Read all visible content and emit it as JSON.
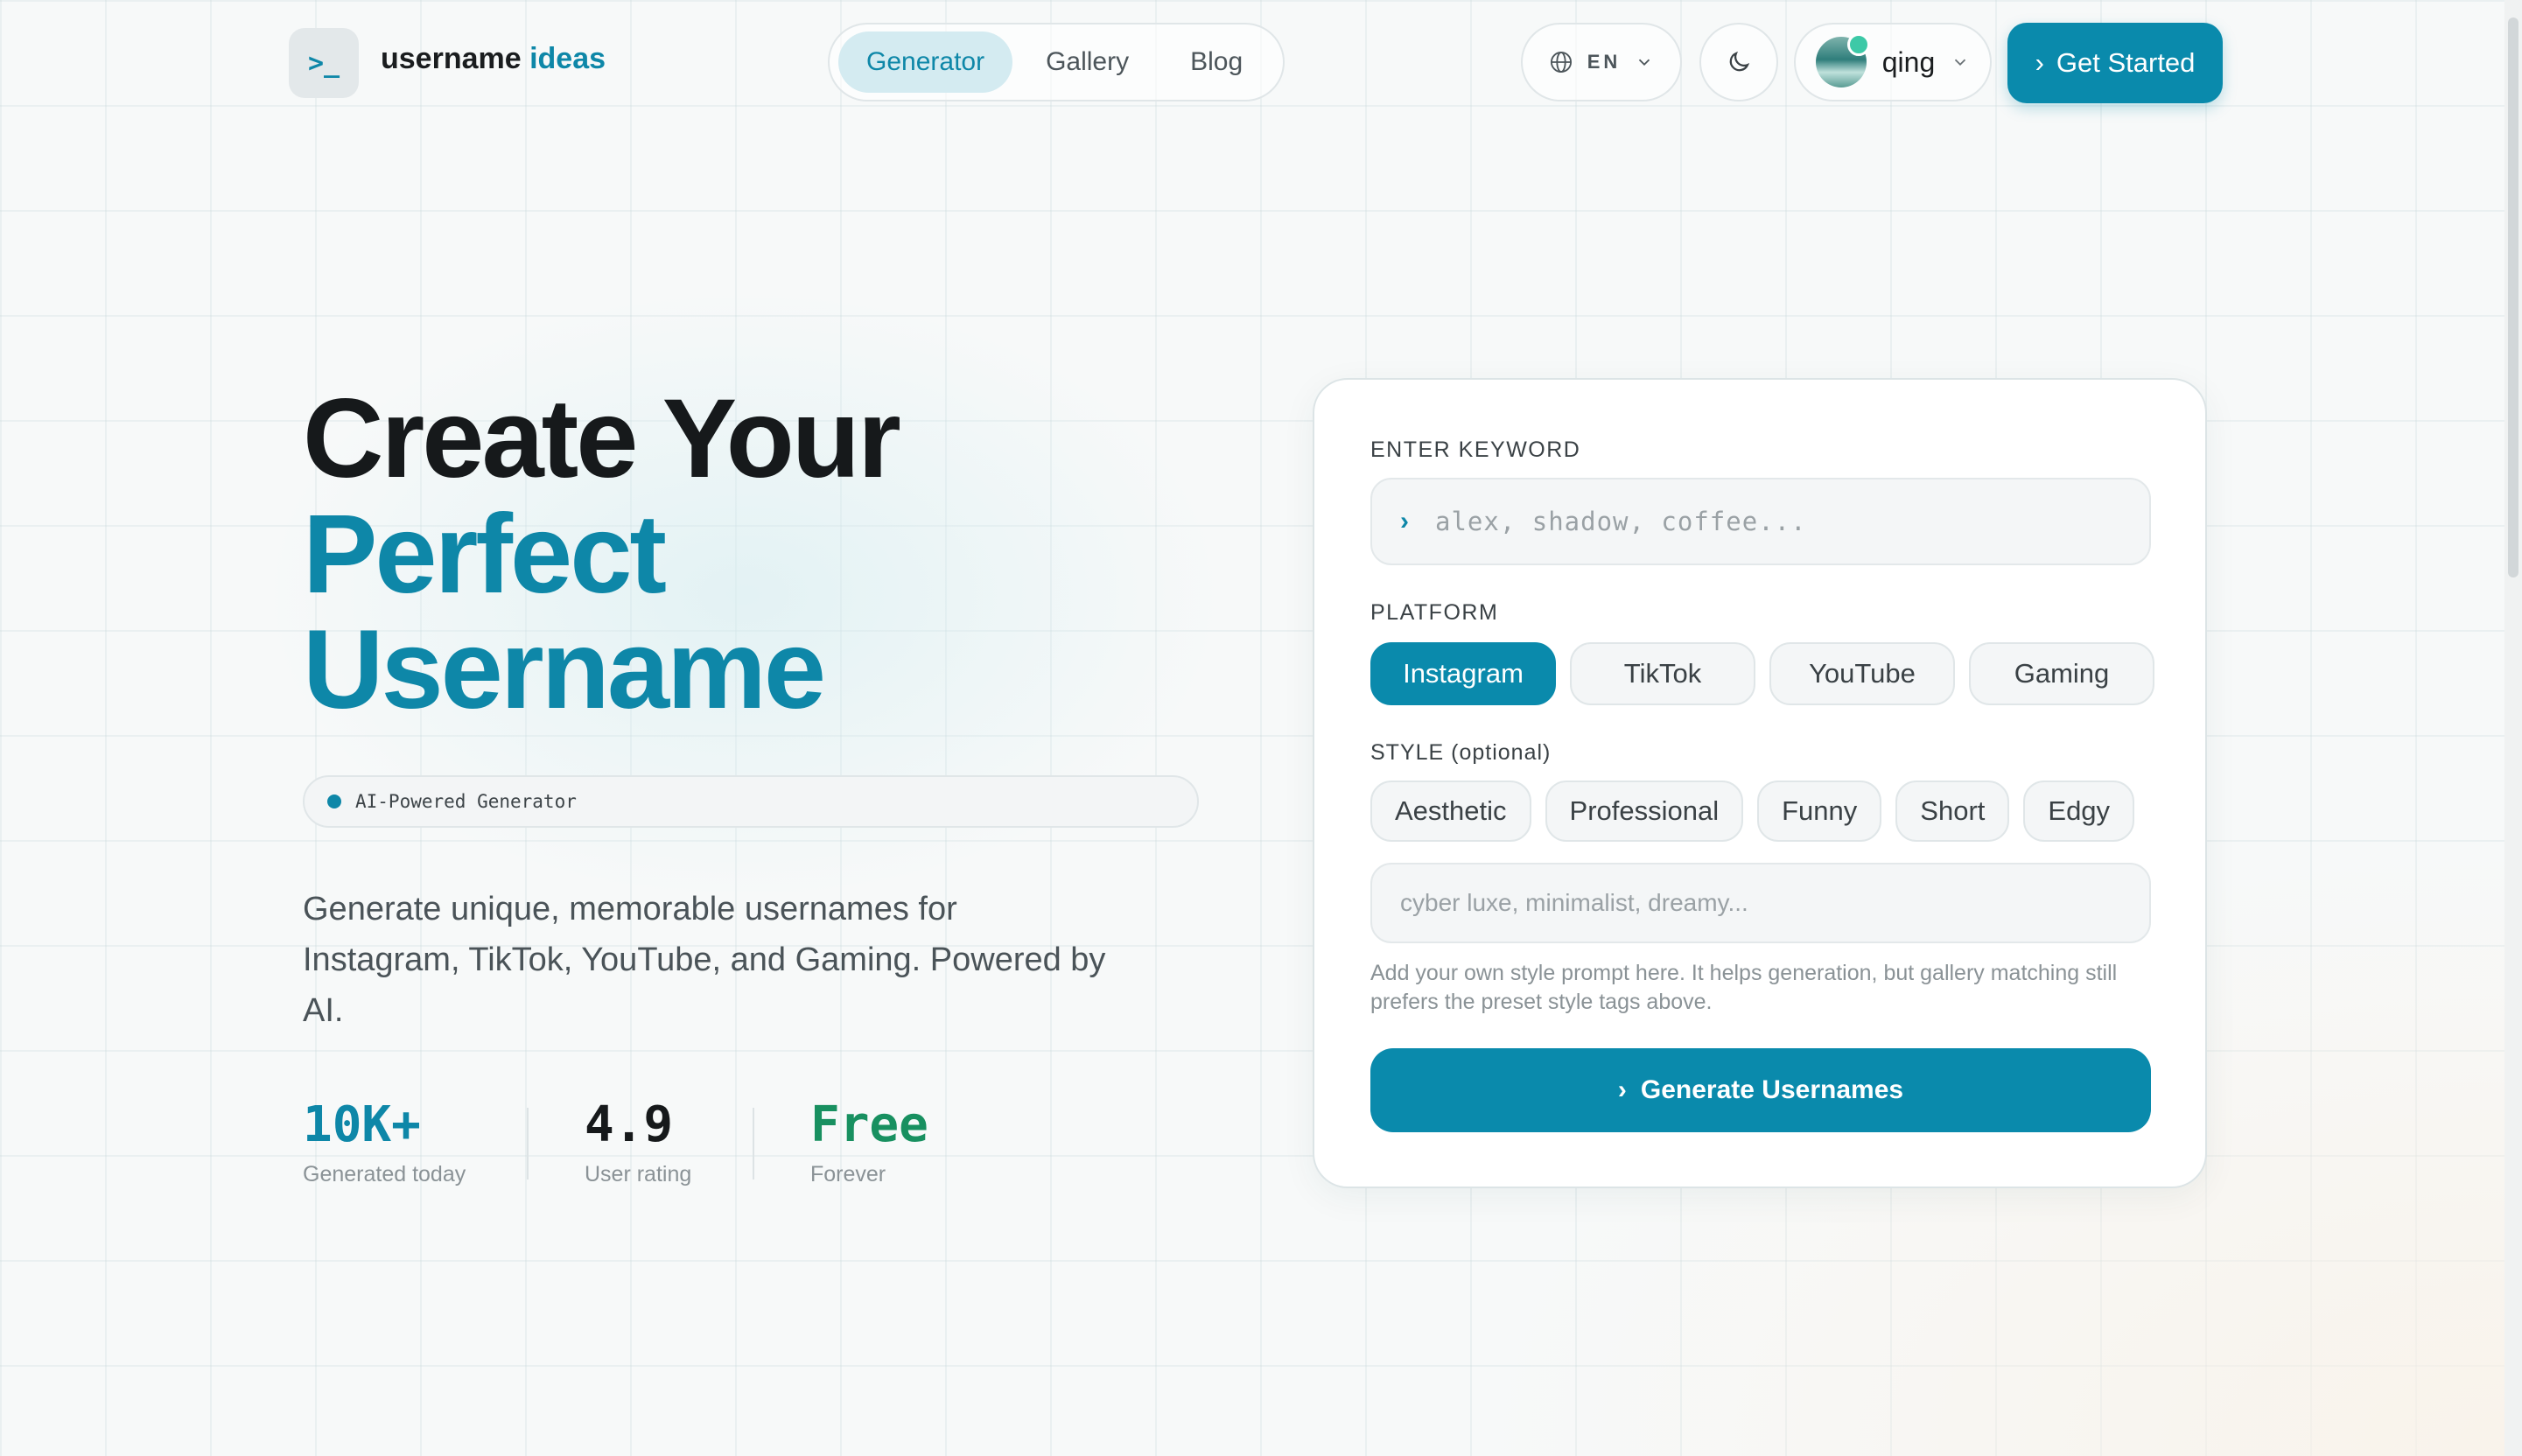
{
  "header": {
    "logo_glyph": ">_",
    "brand_main": "username",
    "brand_accent": "ideas",
    "nav": [
      {
        "label": "Generator",
        "active": true
      },
      {
        "label": "Gallery",
        "active": false
      },
      {
        "label": "Blog",
        "active": false
      }
    ],
    "language": "EN",
    "user_name": "qing",
    "cta_label": "Get Started",
    "cta_glyph": "›"
  },
  "hero": {
    "line1": "Create Your",
    "line2": "Perfect",
    "line3": "Username",
    "badge": "AI-Powered Generator",
    "description": "Generate unique, memorable usernames for Instagram, TikTok, YouTube, and Gaming. Powered by AI.",
    "stats": [
      {
        "value": "10K+",
        "label": "Generated today"
      },
      {
        "value": "4.9",
        "label": "User rating"
      },
      {
        "value": "Free",
        "label": "Forever"
      }
    ]
  },
  "form": {
    "keyword_label": "ENTER KEYWORD",
    "keyword_glyph": "›",
    "keyword_placeholder": "alex, shadow, coffee...",
    "platform_label": "PLATFORM",
    "platforms": [
      {
        "label": "Instagram",
        "selected": true
      },
      {
        "label": "TikTok",
        "selected": false
      },
      {
        "label": "YouTube",
        "selected": false
      },
      {
        "label": "Gaming",
        "selected": false
      }
    ],
    "style_label": "STYLE (optional)",
    "styles": [
      "Aesthetic",
      "Professional",
      "Funny",
      "Short",
      "Edgy"
    ],
    "style_placeholder": "cyber luxe, minimalist, dreamy...",
    "hint": "Add your own style prompt here. It helps generation, but gallery matching still prefers the preset style tags above.",
    "generate_glyph": "›",
    "generate_label": "Generate Usernames"
  },
  "colors": {
    "accent": "#0a8aac",
    "accent_text": "#0e87a8",
    "free_green": "#189060"
  },
  "icons": {
    "language": "globe-icon",
    "language_caret": "chevron-down-icon",
    "theme": "moon-icon",
    "user_caret": "chevron-down-icon"
  }
}
